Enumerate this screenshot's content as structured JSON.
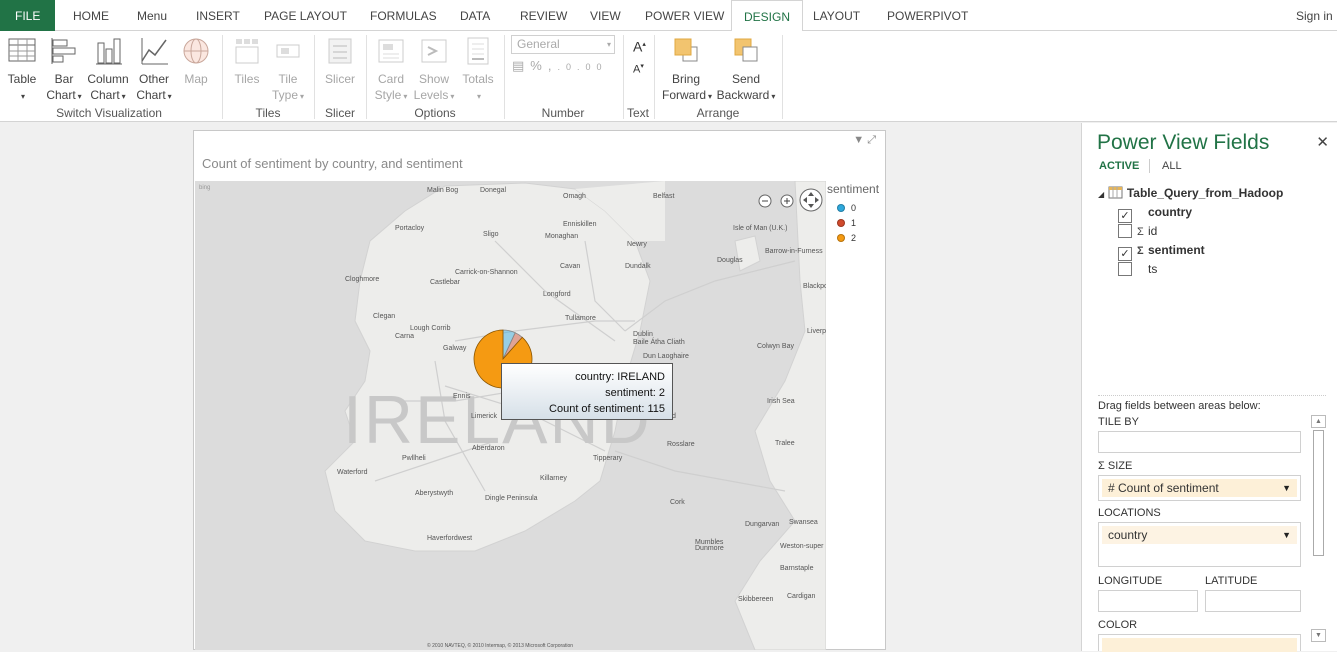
{
  "ribbon_tabs": [
    "FILE",
    "HOME",
    "Menu",
    "INSERT",
    "PAGE LAYOUT",
    "FORMULAS",
    "DATA",
    "REVIEW",
    "VIEW",
    "POWER VIEW",
    "DESIGN",
    "LAYOUT",
    "POWERPIVOT"
  ],
  "sign_in": "Sign in",
  "ribbon": {
    "table": "Table",
    "bar_l1": "Bar",
    "bar_l2": "Chart",
    "col_l1": "Column",
    "col_l2": "Chart",
    "other_l1": "Other",
    "other_l2": "Chart",
    "map": "Map",
    "tiles": "Tiles",
    "tiletype_l1": "Tile",
    "tiletype_l2": "Type",
    "slicer": "Slicer",
    "card_l1": "Card",
    "card_l2": "Style",
    "show_l1": "Show",
    "show_l2": "Levels",
    "totals": "Totals",
    "numfmt": "General",
    "bring_l1": "Bring",
    "bring_l2": "Forward",
    "send_l1": "Send",
    "send_l2": "Backward",
    "groups": {
      "switch": "Switch Visualization",
      "tiles": "Tiles",
      "slicer": "Slicer",
      "options": "Options",
      "number": "Number",
      "text": "Text",
      "arrange": "Arrange"
    }
  },
  "viz": {
    "title": "Count of sentiment by country, and sentiment",
    "legend_title": "sentiment",
    "legend": [
      {
        "label": "0",
        "color": "#2ea8dc"
      },
      {
        "label": "1",
        "color": "#d04a2c"
      },
      {
        "label": "2",
        "color": "#f59a12"
      }
    ],
    "map": {
      "country_label": "IRELAND",
      "places": [
        "Malin Bog",
        "Donegal",
        "Omagh",
        "Belfast",
        "Portacloy",
        "Sligo",
        "Enniskillen",
        "Monaghan",
        "Newry",
        "Isle of Man (U.K.)",
        "Douglas",
        "Barrow-in-Furness",
        "Castlebar",
        "Carrick-on-Shannon",
        "Cavan",
        "Dundalk",
        "Cloghmore",
        "Clegan",
        "Longford",
        "Galway",
        "Dublin",
        "Baile Átha Cliath",
        "Tullamore",
        "Dun Laoghaire",
        "Colwyn Bay",
        "Ennis",
        "Limerick",
        "Irish Sea",
        "Aberdaron",
        "Pwllheli",
        "Tipperary",
        "Tralee",
        "Waterford",
        "Aberystwyth",
        "Dingle Peninsula",
        "Killarney",
        "Cork",
        "Dungarvan",
        "Haverfordwest",
        "Swansea",
        "Skibbereen",
        "Cardigan",
        "Mumbles",
        "Weston-super",
        "Barnstaple",
        "Blackpool",
        "Liverpool",
        "Carna",
        "Lough Corrib",
        "Dunmore",
        "Wexford",
        "Rosslare"
      ],
      "attribution": "© 2010 NAVTEQ, © 2010 Intermap, © 2013 Microsoft Corporation"
    },
    "tooltip": {
      "country": "country: IRELAND",
      "sentiment": "sentiment: 2",
      "count": "Count of sentiment: 115"
    }
  },
  "chart_data": {
    "type": "pie",
    "title": "Count of sentiment by country, and sentiment",
    "location": "IRELAND",
    "series_name": "sentiment",
    "categories": [
      "0",
      "1",
      "2"
    ],
    "values": [
      9,
      6,
      115
    ],
    "colors": [
      "#2ea8dc",
      "#d04a2c",
      "#f59a12"
    ],
    "highlighted": "2"
  },
  "panel": {
    "title": "Power View Fields",
    "tab_active": "ACTIVE",
    "tab_all": "ALL",
    "table_name": "Table_Query_from_Hadoop",
    "fields": [
      {
        "name": "country",
        "checked": true,
        "sigma": false
      },
      {
        "name": "id",
        "checked": false,
        "sigma": true
      },
      {
        "name": "sentiment",
        "checked": true,
        "sigma": true
      },
      {
        "name": "ts",
        "checked": false,
        "sigma": false
      }
    ],
    "drag_hint": "Drag fields between areas below:",
    "tile_by": "TILE BY",
    "size": "SIZE",
    "size_value": "# Count of sentiment",
    "locations": "LOCATIONS",
    "locations_value": "country",
    "longitude": "LONGITUDE",
    "latitude": "LATITUDE",
    "color": "COLOR"
  }
}
